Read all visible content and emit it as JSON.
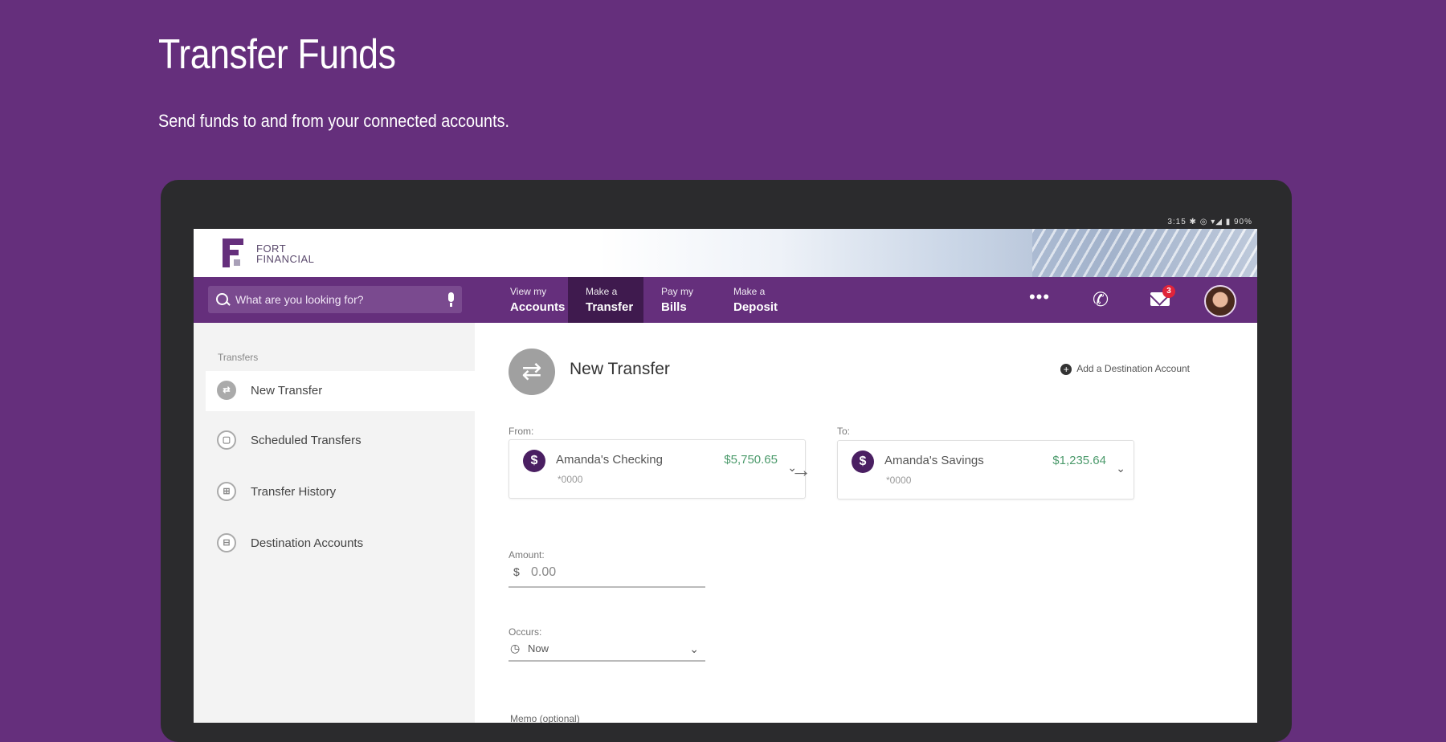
{
  "hero": {
    "title": "Transfer Funds",
    "subtitle": "Send funds to and from your connected accounts."
  },
  "device": {
    "status": "3:15 ✱ ◎ ▾◢ ▮ 90%"
  },
  "brand": {
    "logo_line1": "FORT",
    "logo_line2": "FINANCIAL",
    "color": "#652f7c"
  },
  "nav": {
    "search_placeholder": "What are you looking for?",
    "items": [
      {
        "small": "View my",
        "large": "Accounts"
      },
      {
        "small": "Make a",
        "large": "Transfer"
      },
      {
        "small": "Pay my",
        "large": "Bills"
      },
      {
        "small": "Make a",
        "large": "Deposit"
      }
    ],
    "more": "•••",
    "phone_glyph": "✆",
    "mail_badge": "3"
  },
  "sidebar": {
    "heading": "Transfers",
    "items": [
      {
        "label": "New Transfer",
        "icon": "⇄"
      },
      {
        "label": "Scheduled Transfers",
        "icon": "▢"
      },
      {
        "label": "Transfer History",
        "icon": "⊞"
      },
      {
        "label": "Destination Accounts",
        "icon": "⊟"
      }
    ]
  },
  "main": {
    "title": "New Transfer",
    "add_destination": "Add a Destination Account",
    "from_label": "From:",
    "to_label": "To:",
    "from_account": {
      "name": "Amanda's Checking",
      "number": "*0000",
      "balance": "$5,750.65"
    },
    "to_account": {
      "name": "Amanda's Savings",
      "number": "*0000",
      "balance": "$1,235.64"
    },
    "amount_label": "Amount:",
    "amount_currency": "$",
    "amount_value": "0.00",
    "occurs_label": "Occurs:",
    "occurs_value": "Now",
    "memo_label": "Memo (optional)"
  }
}
